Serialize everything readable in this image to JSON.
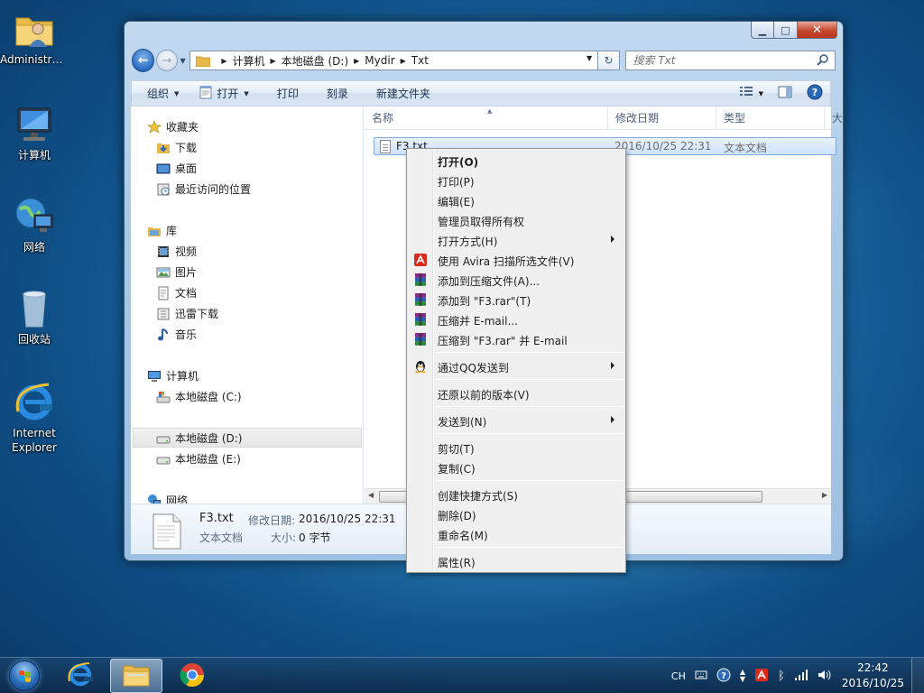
{
  "desktop": {
    "icons": [
      {
        "label": "Administra..."
      },
      {
        "label": "计算机"
      },
      {
        "label": "网络"
      },
      {
        "label": "回收站"
      },
      {
        "label": "Internet Explorer"
      }
    ]
  },
  "window": {
    "address": {
      "crumbs": [
        "计算机",
        "本地磁盘 (D:)",
        "Mydir",
        "Txt"
      ]
    },
    "search": {
      "placeholder": "搜索 Txt"
    },
    "toolbar": {
      "organize": "组织",
      "open": "打开",
      "print": "打印",
      "burn": "刻录",
      "new_folder": "新建文件夹"
    },
    "navpane": {
      "favorites": "收藏夹",
      "downloads": "下载",
      "desktop": "桌面",
      "recent": "最近访问的位置",
      "libraries": "库",
      "videos": "视频",
      "pictures": "图片",
      "documents": "文档",
      "xunlei": "迅雷下载",
      "music": "音乐",
      "computer": "计算机",
      "drive_c": "本地磁盘 (C:)",
      "drive_d": "本地磁盘 (D:)",
      "drive_e": "本地磁盘 (E:)",
      "network": "网络"
    },
    "columns": {
      "name": "名称",
      "date": "修改日期",
      "type": "类型",
      "size": "大"
    },
    "files": [
      {
        "name": "F3.txt",
        "date": "2016/10/25 22:31",
        "type": "文本文档"
      }
    ],
    "details": {
      "filename": "F3.txt",
      "modified_label": "修改日期:",
      "modified_value": "2016/10/25 22:31",
      "type": "文本文档",
      "size_label": "大小:",
      "size_value": "0 字节"
    }
  },
  "context_menu": {
    "open": "打开(O)",
    "print": "打印(P)",
    "edit": "编辑(E)",
    "take_ownership": "管理员取得所有权",
    "open_with": "打开方式(H)",
    "avira_scan": "使用 Avira 扫描所选文件(V)",
    "add_archive": "添加到压缩文件(A)...",
    "add_to_rar": "添加到 \"F3.rar\"(T)",
    "compress_email": "压缩并 E-mail...",
    "compress_rar_email": "压缩到 \"F3.rar\" 并 E-mail",
    "send_qq": "通过QQ发送到",
    "restore_versions": "还原以前的版本(V)",
    "send_to": "发送到(N)",
    "cut": "剪切(T)",
    "copy": "复制(C)",
    "create_shortcut": "创建快捷方式(S)",
    "delete": "删除(D)",
    "rename": "重命名(M)",
    "properties": "属性(R)"
  },
  "taskbar": {
    "lang": "CH",
    "time": "22:42",
    "date": "2016/10/25"
  },
  "colors": {
    "desktop_bg": "#1a6aa3",
    "selection": "#cee3fb",
    "menu_bg": "#f0f0f0",
    "close_btn": "#c5482f"
  },
  "icons": [
    "folder-user-icon",
    "computer-icon",
    "network-icon",
    "recycle-bin-icon",
    "ie-icon",
    "chrome-icon",
    "avira-icon",
    "winrar-icon",
    "qq-icon",
    "text-file-icon"
  ]
}
